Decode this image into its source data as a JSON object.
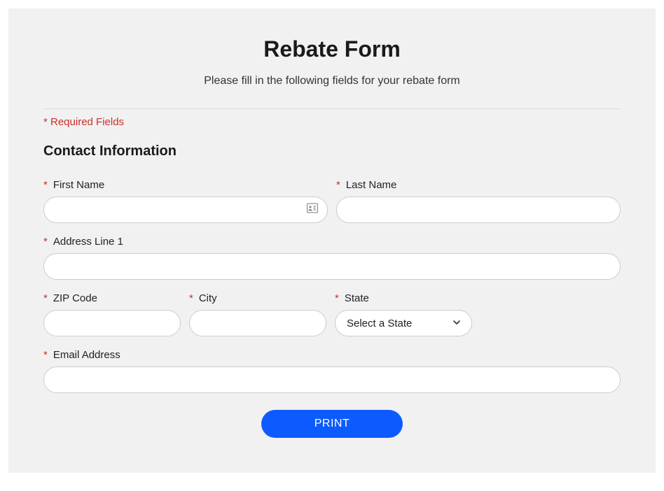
{
  "title": "Rebate Form",
  "subtitle": "Please fill in the following fields for your rebate form",
  "required_note": "* Required Fields",
  "section_title": "Contact Information",
  "req": "*",
  "labels": {
    "first_name": "First Name",
    "last_name": "Last Name",
    "address1": "Address Line 1",
    "zip": "ZIP Code",
    "city": "City",
    "state": "State",
    "email": "Email Address"
  },
  "values": {
    "first_name": "",
    "last_name": "",
    "address1": "",
    "zip": "",
    "city": "",
    "email": ""
  },
  "state_select": {
    "placeholder": "Select a State"
  },
  "print_button": "PRINT"
}
